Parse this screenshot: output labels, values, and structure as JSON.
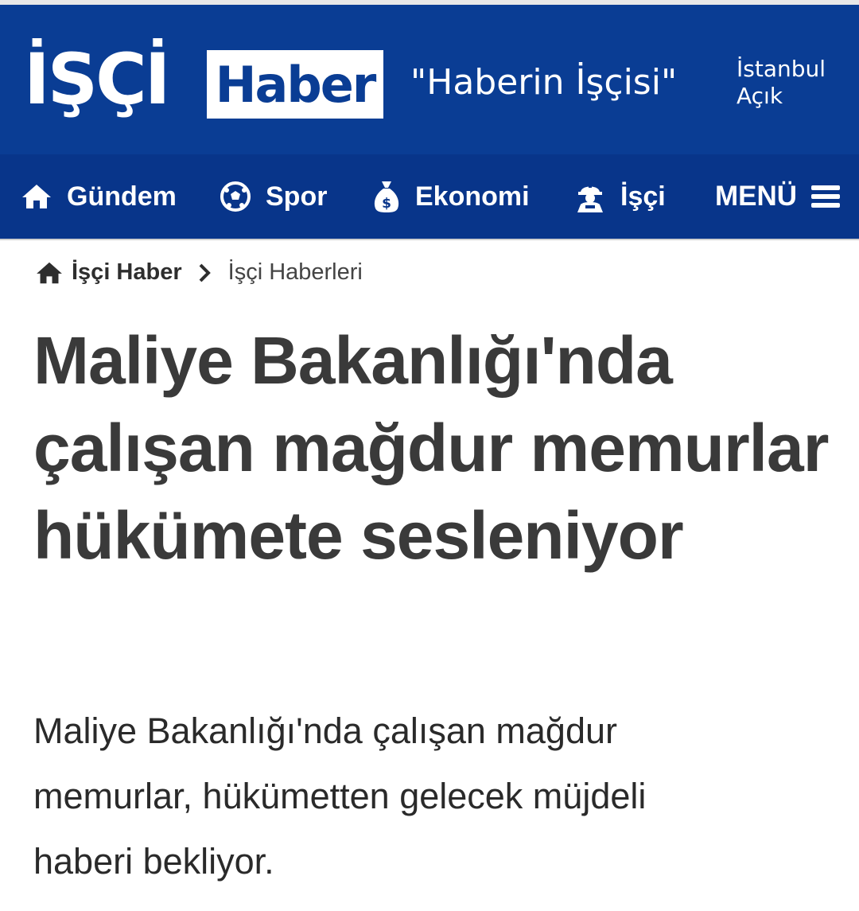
{
  "header": {
    "logo_word": "İŞÇİ",
    "logo_box": "Haber",
    "slogan": "\"Haberin İşçisi\"",
    "weather": {
      "city": "İstanbul",
      "condition": "Açık"
    },
    "colors": {
      "brand": "#0a3d94",
      "nav": "#08358a"
    }
  },
  "nav": {
    "items": [
      {
        "label": "Gündem",
        "icon": "home-icon"
      },
      {
        "label": "Spor",
        "icon": "soccer-ball-icon"
      },
      {
        "label": "Ekonomi",
        "icon": "money-bag-icon"
      },
      {
        "label": "İşçi",
        "icon": "worker-icon"
      }
    ],
    "menu_label": "MENÜ",
    "menu_icon": "hamburger-icon"
  },
  "breadcrumb": {
    "home_label": "İşçi Haber",
    "current": "İşçi Haberleri"
  },
  "article": {
    "title": "Maliye Bakanlığı'nda çalışan mağdur memurlar hükümete sesleniyor",
    "lead": "Maliye Bakanlığı'nda çalışan mağdur memurlar, hükümetten gelecek müjdeli haberi bekliyor."
  }
}
